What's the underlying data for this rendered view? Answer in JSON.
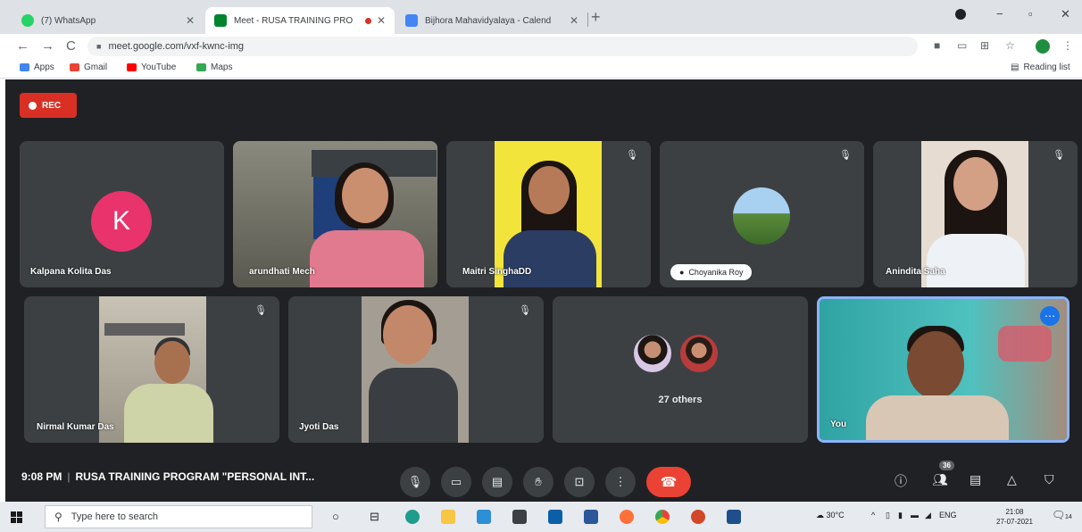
{
  "browser": {
    "tabs": [
      {
        "title": "(7) WhatsApp",
        "active": false,
        "icon": "whatsapp-icon"
      },
      {
        "title": "Meet - RUSA TRAINING PRO",
        "active": true,
        "icon": "meet-icon"
      },
      {
        "title": "Bijhora Mahavidyalaya - Calend",
        "active": false,
        "icon": "calendar-icon"
      }
    ],
    "url": "meet.google.com/vxf-kwnc-img",
    "bookmarks": [
      {
        "label": "Apps",
        "icon": "apps-icon"
      },
      {
        "label": "Gmail",
        "icon": "gmail-icon"
      },
      {
        "label": "YouTube",
        "icon": "youtube-icon"
      },
      {
        "label": "Maps",
        "icon": "maps-icon"
      }
    ],
    "reading_list": "Reading list"
  },
  "meet": {
    "rec_label": "REC",
    "participants_row1": [
      {
        "name": "Kalpana Kolita Das",
        "avatar_letter": "K"
      },
      {
        "name": "arundhati Mech"
      },
      {
        "name": "Maitri SinghaDD"
      },
      {
        "name": "Choyanika Roy"
      },
      {
        "name": "Anindita Saha"
      }
    ],
    "participants_row2": [
      {
        "name": "Nirmal Kumar Das"
      },
      {
        "name": "Jyoti Das"
      },
      {
        "name": "27 others"
      },
      {
        "name": "You"
      }
    ],
    "time": "9:08 PM",
    "meeting_title": "RUSA TRAINING PROGRAM \"PERSONAL INT...",
    "people_count": "36",
    "colors": {
      "end_call": "#ea4335",
      "rec": "#d93025",
      "avatar_k": "#e8336d",
      "self_border": "#8ab4f8"
    }
  },
  "taskbar": {
    "search_placeholder": "Type here to search",
    "weather": "30°C",
    "lang": "ENG",
    "time": "21:08",
    "date": "27-07-2021",
    "notification_count": "14"
  }
}
